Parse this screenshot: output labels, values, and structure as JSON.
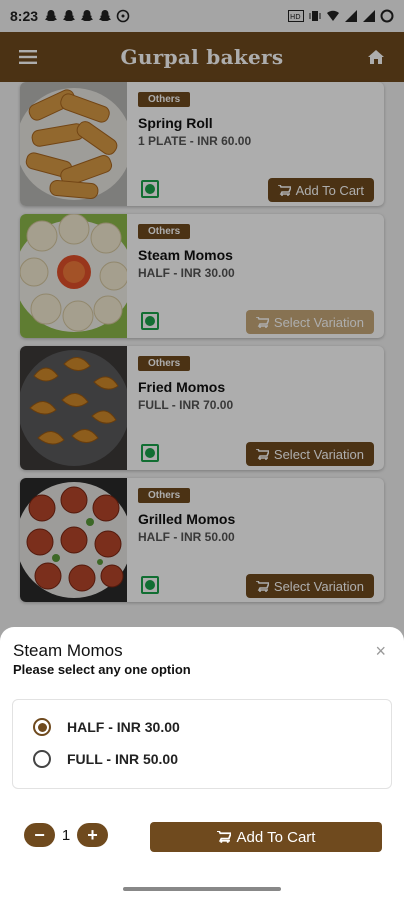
{
  "status_bar": {
    "time": "8:23"
  },
  "app_bar": {
    "title": "Gurpal bakers",
    "menu_icon": "hamburger-icon",
    "home_icon": "home-icon",
    "color": "#6f4a1e"
  },
  "products": [
    {
      "category": "Others",
      "name": "Spring Roll",
      "price": "1 PLATE - INR 60.00",
      "action": "Add To Cart"
    },
    {
      "category": "Others",
      "name": "Steam Momos",
      "price": "HALF - INR 30.00",
      "action": "Select Variation"
    },
    {
      "category": "Others",
      "name": "Fried Momos",
      "price": "FULL - INR 70.00",
      "action": "Select Variation"
    },
    {
      "category": "Others",
      "name": "Grilled Momos",
      "price": "HALF - INR 50.00",
      "action": "Select Variation"
    }
  ],
  "sheet": {
    "title": "Steam Momos",
    "subtitle": "Please select any one option",
    "close": "×",
    "options": [
      {
        "label": "HALF - INR 30.00",
        "selected": true
      },
      {
        "label": "FULL - INR 50.00",
        "selected": false
      }
    ],
    "quantity": "1",
    "minus": "−",
    "plus": "+",
    "add_to_cart": "Add To Cart"
  }
}
